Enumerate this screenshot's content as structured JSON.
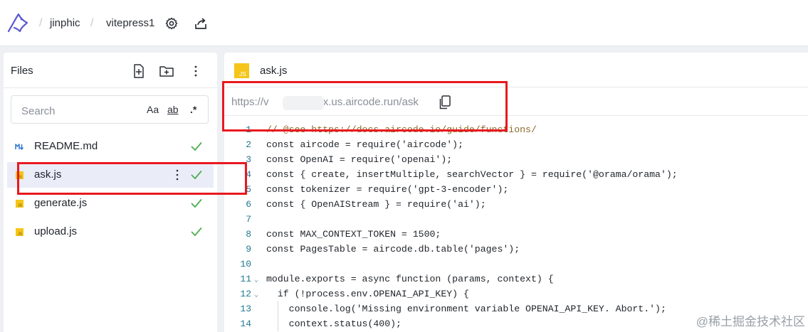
{
  "header": {
    "breadcrumbs": [
      {
        "label": "jinphic"
      },
      {
        "label": "vitepress1"
      }
    ],
    "separator": "/"
  },
  "files_panel": {
    "title": "Files",
    "search": {
      "placeholder": "Search",
      "value": "",
      "options": [
        "Aa",
        "ab",
        ".*"
      ]
    },
    "files": [
      {
        "name": "README.md",
        "icon": "markdown-icon",
        "status": "deployed-check"
      },
      {
        "name": "ask.js",
        "icon": "js-file-icon",
        "status": "deployed-check",
        "selected": true
      },
      {
        "name": "generate.js",
        "icon": "js-file-icon",
        "status": "deployed-check"
      },
      {
        "name": "upload.js",
        "icon": "js-file-icon",
        "status": "deployed-check"
      }
    ]
  },
  "editor": {
    "tab": {
      "name": "ask.js",
      "icon_label": "JS"
    },
    "url": {
      "prefix": "https://v",
      "suffix": ".x.us.aircode.run/ask"
    },
    "lines": [
      {
        "n": "1",
        "text": "// @see https://docs.aircode.io/guide/functions/"
      },
      {
        "n": "2",
        "text": "const aircode = require('aircode');"
      },
      {
        "n": "3",
        "text": "const OpenAI = require('openai');"
      },
      {
        "n": "4",
        "text": "const { create, insertMultiple, searchVector } = require('@orama/orama');"
      },
      {
        "n": "5",
        "text": "const tokenizer = require('gpt-3-encoder');"
      },
      {
        "n": "6",
        "text": "const { OpenAIStream } = require('ai');"
      },
      {
        "n": "7",
        "text": ""
      },
      {
        "n": "8",
        "text": "const MAX_CONTEXT_TOKEN = 1500;"
      },
      {
        "n": "9",
        "text": "const PagesTable = aircode.db.table('pages');"
      },
      {
        "n": "10",
        "text": ""
      },
      {
        "n": "11",
        "text": "module.exports = async function (params, context) {"
      },
      {
        "n": "12",
        "text": "  if (!process.env.OPENAI_API_KEY) {"
      },
      {
        "n": "13",
        "text": "    console.log('Missing environment variable OPENAI_API_KEY. Abort.');"
      },
      {
        "n": "14",
        "text": "    context.status(400);"
      }
    ]
  },
  "watermark": "@稀土掘金技术社区",
  "colors": {
    "accent_red": "#e8191f",
    "check_green": "#4caf50",
    "js_yellow": "#f5c518",
    "selected_row": "#eaedf8"
  }
}
